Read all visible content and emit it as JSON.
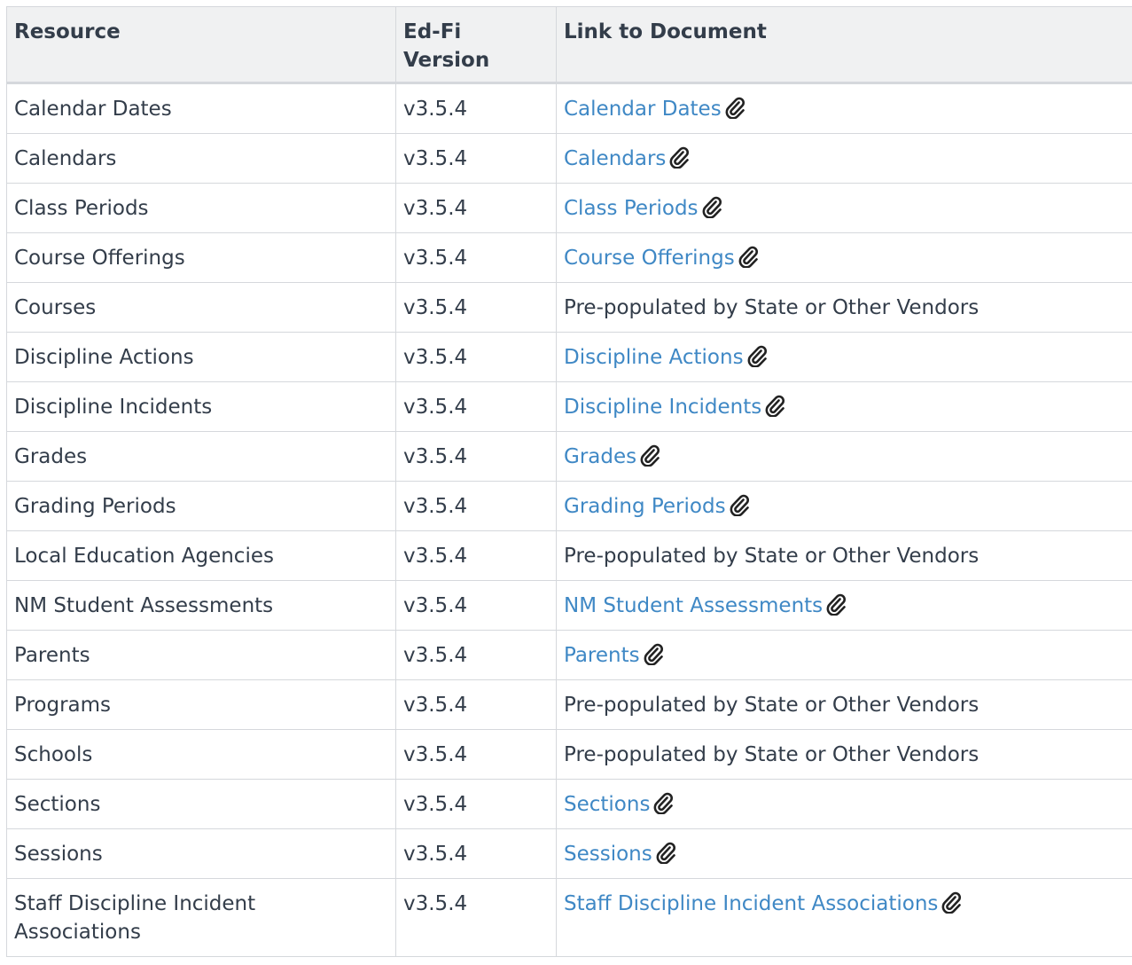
{
  "headers": {
    "resource": "Resource",
    "version": "Ed-Fi Version",
    "link": "Link to Document"
  },
  "rows": [
    {
      "resource": "Calendar Dates",
      "version": "v3.5.4",
      "link": "Calendar Dates",
      "is_link": true
    },
    {
      "resource": "Calendars",
      "version": "v3.5.4",
      "link": "Calendars",
      "is_link": true
    },
    {
      "resource": "Class Periods",
      "version": "v3.5.4",
      "link": "Class Periods",
      "is_link": true
    },
    {
      "resource": "Course Offerings",
      "version": "v3.5.4",
      "link": "Course Offerings",
      "is_link": true
    },
    {
      "resource": "Courses",
      "version": "v3.5.4",
      "link": "Pre-populated by State or Other Vendors",
      "is_link": false
    },
    {
      "resource": "Discipline Actions",
      "version": "v3.5.4",
      "link": "Discipline Actions",
      "is_link": true
    },
    {
      "resource": "Discipline Incidents",
      "version": "v3.5.4",
      "link": "Discipline Incidents",
      "is_link": true
    },
    {
      "resource": "Grades",
      "version": "v3.5.4",
      "link": "Grades",
      "is_link": true
    },
    {
      "resource": "Grading Periods",
      "version": "v3.5.4",
      "link": "Grading Periods",
      "is_link": true
    },
    {
      "resource": "Local Education Agencies",
      "version": "v3.5.4",
      "link": "Pre-populated by State or Other Vendors",
      "is_link": false
    },
    {
      "resource": "NM Student Assessments",
      "version": "v3.5.4",
      "link": "NM Student Assessments",
      "is_link": true
    },
    {
      "resource": "Parents",
      "version": "v3.5.4",
      "link": "Parents",
      "is_link": true
    },
    {
      "resource": "Programs",
      "version": "v3.5.4",
      "link": "Pre-populated by State or Other Vendors",
      "is_link": false
    },
    {
      "resource": "Schools",
      "version": "v3.5.4",
      "link": "Pre-populated by State or Other Vendors",
      "is_link": false
    },
    {
      "resource": "Sections",
      "version": "v3.5.4",
      "link": "Sections",
      "is_link": true
    },
    {
      "resource": "Sessions",
      "version": "v3.5.4",
      "link": "Sessions",
      "is_link": true
    },
    {
      "resource": "Staff Discipline Incident Associations",
      "version": "v3.5.4",
      "link": "Staff Discipline Incident Associations",
      "is_link": true
    }
  ],
  "icons": {
    "attachment": "paperclip-icon"
  },
  "colors": {
    "link": "#3f88c5",
    "text": "#333d4a",
    "header_bg": "#f0f1f2",
    "border": "#d5d8dc"
  }
}
